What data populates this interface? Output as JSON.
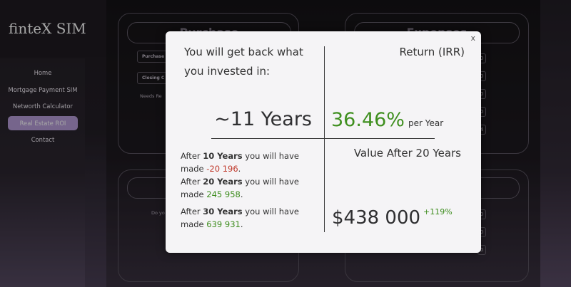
{
  "app": {
    "brand": "finteX SIM"
  },
  "sidebar": {
    "items": [
      {
        "label": "Home"
      },
      {
        "label": "Mortgage Payment SIM"
      },
      {
        "label": "Networth Calculator"
      },
      {
        "label": "Real Estate ROI",
        "active": true
      },
      {
        "label": "Contact"
      }
    ]
  },
  "background": {
    "card_purchase_title": "Purchase",
    "card_expenses_title": "Expenses",
    "purchase_field": "Purchase",
    "closing_field": "Closing C",
    "needs_text": "Needs Re",
    "do_text": "Do yo",
    "right_digits": [
      "0",
      "0",
      "0",
      "0",
      "4"
    ],
    "right_digits_bottom": [
      "0",
      "0",
      "0"
    ]
  },
  "modal": {
    "close_label": "x",
    "payback_question": "You will get back what you invested in:",
    "payback_value": "~11 Years",
    "irr_title": "Return (IRR)",
    "irr_value": "36.46%",
    "irr_unit": "per Year",
    "after_items": [
      {
        "prefix": "After ",
        "years": "10 Years",
        "suffix": " you will have made ",
        "amount": "-20 196",
        "period": ".",
        "sign": "neg"
      },
      {
        "prefix": "After ",
        "years": "20 Years",
        "suffix": " you will have made ",
        "amount": "245 958",
        "period": ".",
        "sign": "pos"
      },
      {
        "prefix": "After ",
        "years": "30 Years",
        "suffix": " you will have made ",
        "amount": "639 931",
        "period": ".",
        "sign": "pos"
      }
    ],
    "value_after_title": "Value After 20 Years",
    "value_after_amount": "$438 000",
    "value_after_pct": "+119%"
  },
  "colors": {
    "accent_purple": "#b69cd8",
    "positive_green": "#3c8c1c",
    "negative_red": "#c0392b",
    "irr_green": "#3f8f1f"
  }
}
